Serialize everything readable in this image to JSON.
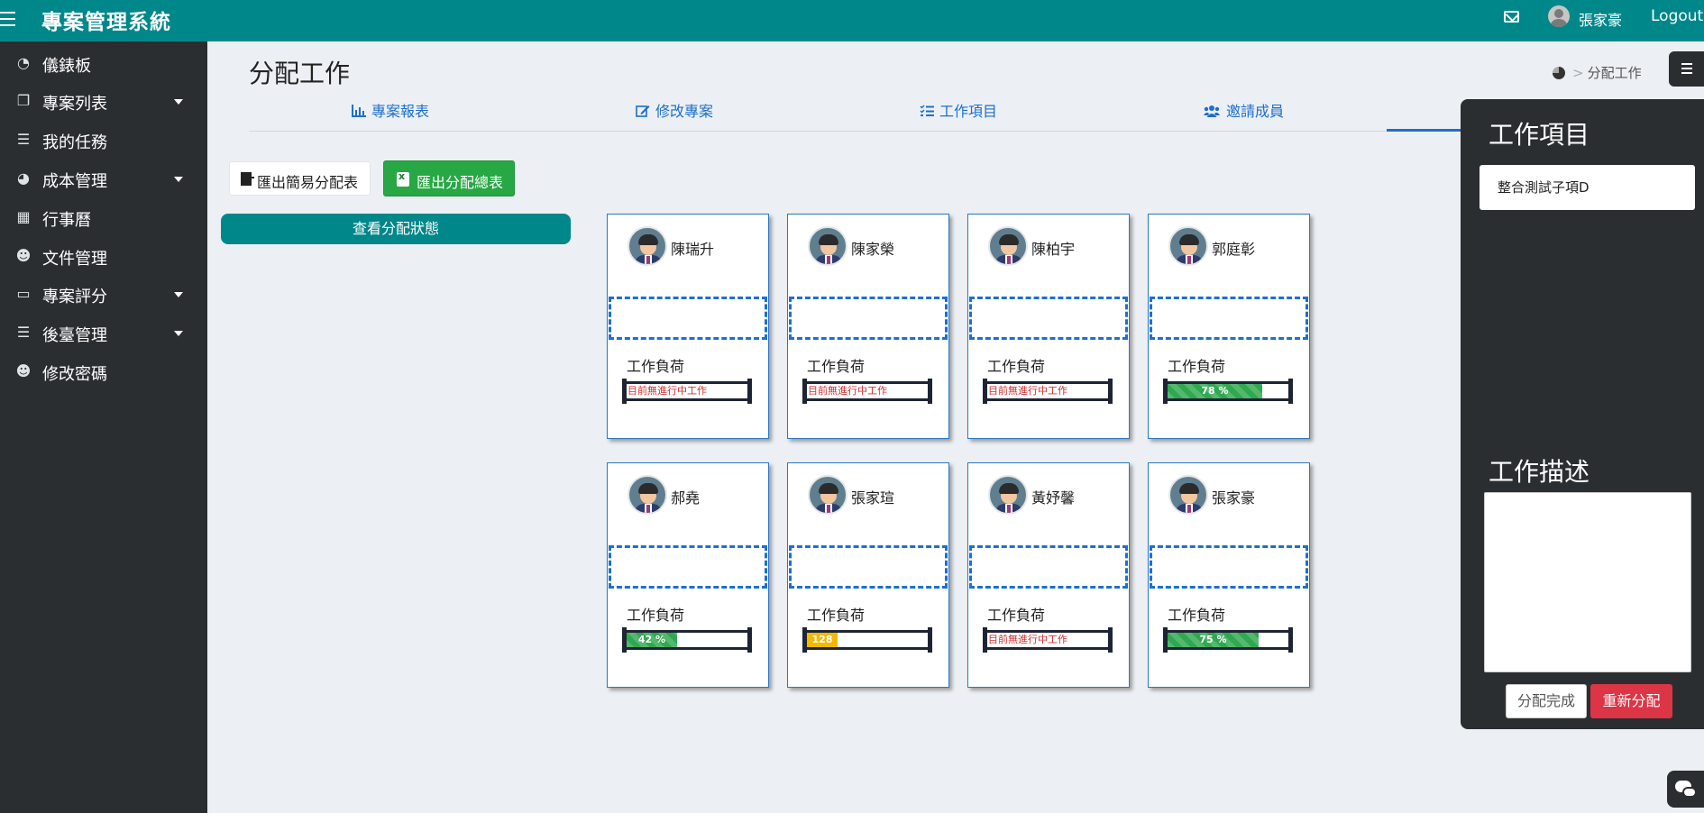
{
  "app": {
    "title": "專案管理系統",
    "user_name": "張家豪",
    "logout_label": "Logout"
  },
  "sidebar": {
    "items": [
      {
        "label": "儀錶板",
        "icon": "dashboard-icon",
        "has_submenu": false
      },
      {
        "label": "專案列表",
        "icon": "copy-icon",
        "has_submenu": true
      },
      {
        "label": "我的任務",
        "icon": "tasks-icon",
        "has_submenu": false
      },
      {
        "label": "成本管理",
        "icon": "pie-chart-icon",
        "has_submenu": true
      },
      {
        "label": "行事曆",
        "icon": "calendar-icon",
        "has_submenu": false
      },
      {
        "label": "文件管理",
        "icon": "users-icon",
        "has_submenu": false
      },
      {
        "label": "專案評分",
        "icon": "laptop-icon",
        "has_submenu": true
      },
      {
        "label": "後臺管理",
        "icon": "tasks-icon",
        "has_submenu": true
      },
      {
        "label": "修改密碼",
        "icon": "users-icon",
        "has_submenu": false
      }
    ]
  },
  "page": {
    "title": "分配工作",
    "breadcrumb_current": "分配工作"
  },
  "tabs": [
    {
      "label": "專案報表",
      "icon": "bar-chart-icon"
    },
    {
      "label": "修改專案",
      "icon": "edit-icon"
    },
    {
      "label": "工作項目",
      "icon": "list-icon"
    },
    {
      "label": "邀請成員",
      "icon": "users-icon"
    }
  ],
  "actions": {
    "export_simple": "匯出簡易分配表",
    "export_total": "匯出分配總表",
    "view_status": "查看分配狀態"
  },
  "members": [
    {
      "name": "陳瑞升",
      "workload_label": "工作負荷",
      "workload_percent": null,
      "workload_text": "目前無進行中工作"
    },
    {
      "name": "陳家榮",
      "workload_label": "工作負荷",
      "workload_percent": null,
      "workload_text": "目前無進行中工作"
    },
    {
      "name": "陳柏宇",
      "workload_label": "工作負荷",
      "workload_percent": null,
      "workload_text": "目前無進行中工作"
    },
    {
      "name": "郭庭彰",
      "workload_label": "工作負荷",
      "workload_percent": 78,
      "workload_text": "78 %",
      "bar_color": "green"
    },
    {
      "name": "郝堯",
      "workload_label": "工作負荷",
      "workload_percent": 42,
      "workload_text": "42 %",
      "bar_color": "green"
    },
    {
      "name": "張家瑄",
      "workload_label": "工作負荷",
      "workload_percent": 128,
      "workload_text": "128 %",
      "bar_color": "yellow"
    },
    {
      "name": "黃妤馨",
      "workload_label": "工作負荷",
      "workload_percent": null,
      "workload_text": "目前無進行中工作"
    },
    {
      "name": "張家豪",
      "workload_label": "工作負荷",
      "workload_percent": 75,
      "workload_text": "75 %",
      "bar_color": "green"
    }
  ],
  "right_panel": {
    "task_heading": "工作項目",
    "task_value": "整合測試子項D",
    "desc_heading": "工作描述",
    "desc_value": "",
    "done_label": "分配完成",
    "reassign_label": "重新分配"
  },
  "colors": {
    "primary": "#00878a",
    "dark": "#2b2e31",
    "link": "#1e6fcf",
    "success": "#28a745",
    "danger": "#dc3545",
    "warning": "#f5b800"
  }
}
